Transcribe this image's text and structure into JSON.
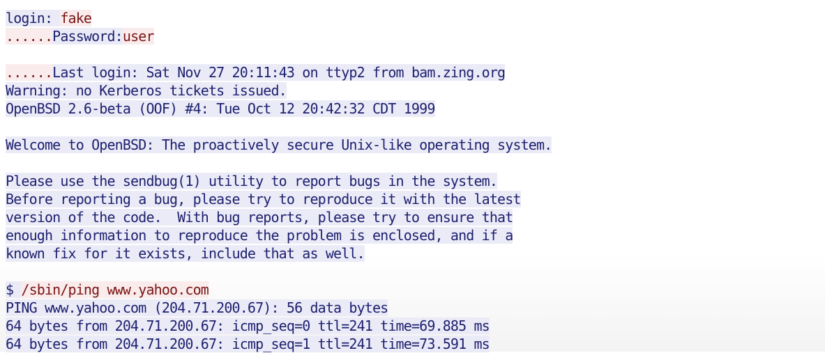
{
  "session": {
    "login_prompt": "login: ",
    "login_value": "fake",
    "password_dots": "......",
    "password_prompt": "Password:",
    "password_value": "user",
    "motd_dots": "......",
    "last_login": "Last login: Sat Nov 27 20:11:43 on ttyp2 from bam.zing.org",
    "kerberos_warning": "Warning: no Kerberos tickets issued.",
    "os_version": "OpenBSD 2.6-beta (OOF) #4: Tue Oct 12 20:42:32 CDT 1999",
    "welcome": "Welcome to OpenBSD: The proactively secure Unix-like operating system.",
    "notice": [
      "Please use the sendbug(1) utility to report bugs in the system.",
      "Before reporting a bug, please try to reproduce it with the latest",
      "version of the code.  With bug reports, please try to ensure that",
      "enough information to reproduce the problem is enclosed, and if a",
      "known fix for it exists, include that as well."
    ],
    "shell_prompt": "$ ",
    "command": "/sbin/ping www.yahoo.com",
    "ping_header": "PING www.yahoo.com (204.71.200.67): 56 data bytes",
    "ping_replies": [
      "64 bytes from 204.71.200.67: icmp_seq=0 ttl=241 time=69.885 ms",
      "64 bytes from 204.71.200.67: icmp_seq=1 ttl=241 time=73.591 ms"
    ]
  }
}
